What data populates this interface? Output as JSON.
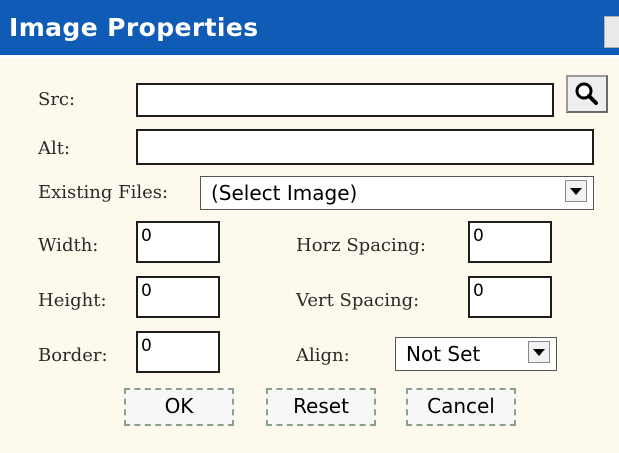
{
  "dialog": {
    "title": "Image Properties"
  },
  "fields": {
    "src_label": "Src:",
    "src_value": "",
    "alt_label": "Alt:",
    "alt_value": "",
    "existing_label": "Existing Files:",
    "existing_value": "(Select Image)",
    "width_label": "Width:",
    "width_value": "0",
    "height_label": "Height:",
    "height_value": "0",
    "border_label": "Border:",
    "border_value": "0",
    "hspace_label": "Horz Spacing:",
    "hspace_value": "0",
    "vspace_label": "Vert Spacing:",
    "vspace_value": "0",
    "align_label": "Align:",
    "align_value": "Not Set"
  },
  "buttons": {
    "ok": "OK",
    "reset": "Reset",
    "cancel": "Cancel"
  },
  "icons": {
    "browse": "magnifier-icon",
    "dropdown": "chevron-down-icon"
  },
  "colors": {
    "titlebar": "#0f5bb5",
    "dialog_bg": "#fdf9ec"
  }
}
